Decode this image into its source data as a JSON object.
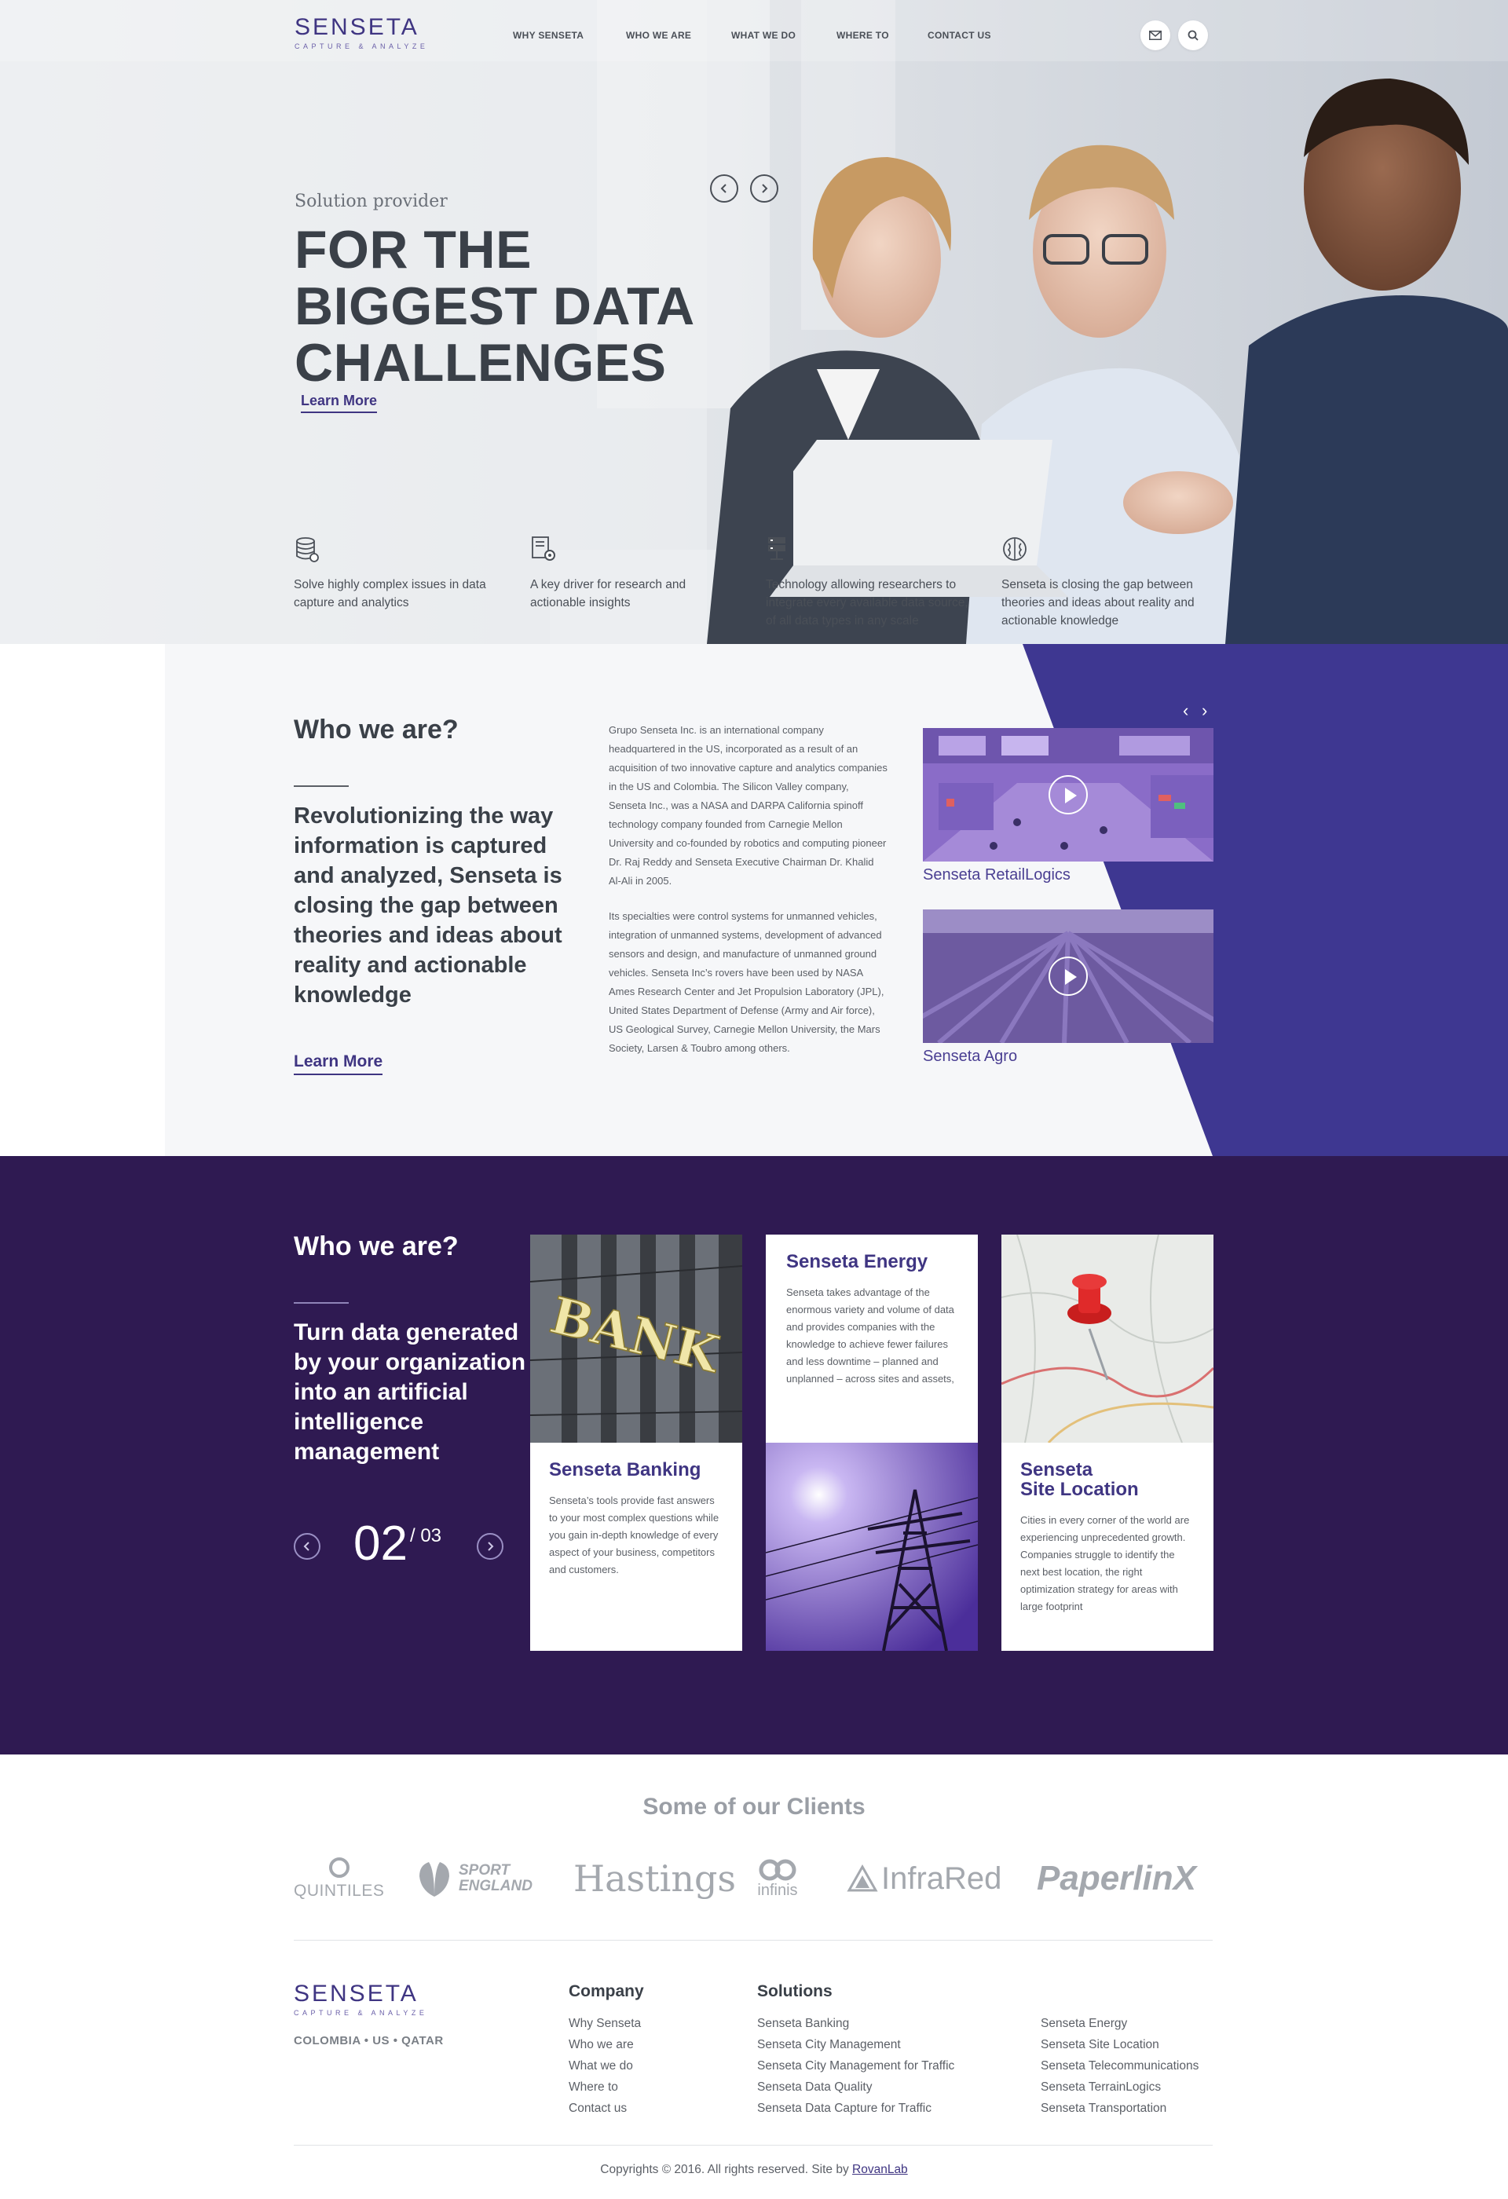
{
  "header": {
    "logo": {
      "word": "SENSETA",
      "tagline": "CAPTURE & ANALYZE"
    },
    "nav": [
      "WHY SENSETA",
      "WHO WE ARE",
      "WHAT WE DO",
      "WHERE TO",
      "CONTACT US"
    ],
    "icons": [
      "mail-icon",
      "search-icon"
    ]
  },
  "hero": {
    "kicker": "Solution provider",
    "title_lines": [
      "FOR THE",
      "BIGGEST DATA",
      "CHALLENGES"
    ],
    "learn_more": "Learn More",
    "features": [
      {
        "icon": "database-icon",
        "text": "Solve highly complex issues in data capture and analytics"
      },
      {
        "icon": "settings-document-icon",
        "text": "A key driver for research and actionable insights"
      },
      {
        "icon": "server-icon",
        "text": "Technology allowing researchers to integrate every available data source, of all data types in any scale"
      },
      {
        "icon": "brain-icon",
        "text": "Senseta is closing the gap between theories and ideas about reality and actionable knowledge"
      }
    ]
  },
  "who": {
    "heading": "Who we are?",
    "lead": "Revolutionizing the way information is captured and analyzed, Senseta is closing the gap between theories and ideas about reality and actionable knowledge",
    "learn_more": "Learn More",
    "paragraph1": "Grupo Senseta Inc. is an international company headquartered in the US, incorporated as a result of an acquisition of two innovative capture and analytics companies in the US and Colombia. The Silicon Valley company, Senseta Inc., was a NASA and DARPA California spinoff technology company founded from Carnegie Mellon University and co-founded by robotics and computing pioneer Dr. Raj Reddy and Senseta Executive Chairman Dr. Khalid Al-Ali in 2005.",
    "paragraph2": "Its specialties were control systems for unmanned vehicles, integration of unmanned systems, development of advanced sensors and design, and manufacture of unmanned ground vehicles. Senseta Inc’s rovers have been used by NASA Ames Research Center and Jet Propulsion Laboratory (JPL), United States Department of Defense (Army and Air force), US Geological Survey, Carnegie Mellon University, the Mars Society, Larsen & Toubro among others.",
    "videos": [
      {
        "label": "Senseta RetailLogics"
      },
      {
        "label": "Senseta Agro"
      }
    ]
  },
  "solutions": {
    "heading": "Who we are?",
    "lead": "Turn data generated by your organization into an artificial intelligence management",
    "counter_current": "02",
    "counter_total": "/ 03",
    "bank_sign": "BANK",
    "cards": [
      {
        "title": "Senseta Banking",
        "text": "Senseta’s tools provide fast answers to your most complex questions while you gain in-depth knowledge of every aspect of your business, competitors and customers."
      },
      {
        "title": "Senseta Energy",
        "text": "Senseta takes advantage of the enormous variety and volume of data and provides companies  with the knowledge to achieve fewer failures and less downtime – planned and unplanned – across sites and assets,"
      },
      {
        "title_line1": "Senseta",
        "title_line2": "Site Location",
        "text": "Cities in every corner of the world are experiencing unprecedented growth. Companies struggle to identify the next best location, the right optimization strategy for areas with large footprint"
      }
    ]
  },
  "clients": {
    "heading": "Some of our Clients",
    "logos": [
      "QUINTILES",
      "SPORT ENGLAND",
      "Hastings",
      "infinis",
      "InfraRed",
      "PaperlinX"
    ]
  },
  "footer": {
    "logo": {
      "word": "SENSETA",
      "tagline": "CAPTURE & ANALYZE"
    },
    "locations": "COLOMBIA • US • QATAR",
    "company_heading": "Company",
    "company_links": [
      "Why Senseta",
      "Who we are",
      "What we do",
      "Where to",
      "Contact us"
    ],
    "solutions_heading": "Solutions",
    "solutions_links_col1": [
      "Senseta Banking",
      "Senseta City Management",
      "Senseta City Management for Traffic",
      "Senseta Data Quality",
      "Senseta Data Capture for Traffic"
    ],
    "solutions_links_col2": [
      "Senseta Energy",
      "Senseta Site Location",
      "Senseta Telecommunications",
      "Senseta TerrainLogics",
      "Senseta Transportation"
    ],
    "copyright": "Copyrights © 2016. All rights reserved. Site by ",
    "credit": "RovanLab"
  },
  "colors": {
    "brand": "#3f3582",
    "dark_section": "#2f1a52",
    "accent_purple": "#3e3791"
  }
}
